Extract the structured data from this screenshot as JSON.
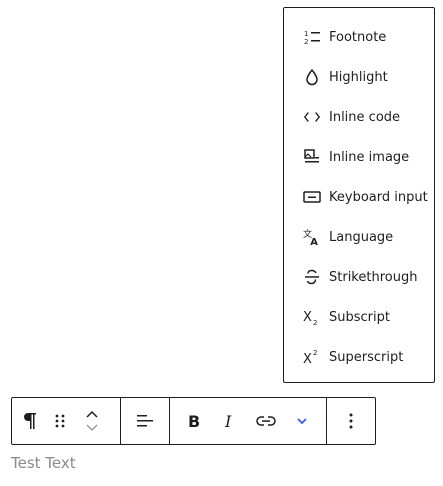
{
  "menu": {
    "items": [
      {
        "label": "Footnote",
        "icon": "footnote-icon"
      },
      {
        "label": "Highlight",
        "icon": "highlight-icon"
      },
      {
        "label": "Inline code",
        "icon": "inline-code-icon"
      },
      {
        "label": "Inline image",
        "icon": "inline-image-icon"
      },
      {
        "label": "Keyboard input",
        "icon": "keyboard-input-icon"
      },
      {
        "label": "Language",
        "icon": "language-icon"
      },
      {
        "label": "Strikethrough",
        "icon": "strikethrough-icon"
      },
      {
        "label": "Subscript",
        "icon": "subscript-icon"
      },
      {
        "label": "Superscript",
        "icon": "superscript-icon"
      }
    ]
  },
  "toolbar": {
    "buttons": [
      "paragraph-icon",
      "drag-handle-icon",
      "move-up-down-icon",
      "align-icon",
      "bold-icon",
      "italic-icon",
      "link-icon",
      "chevron-down-icon",
      "more-options-icon"
    ],
    "accent_color": "#3858e9"
  },
  "editor": {
    "text": "Test Text"
  }
}
